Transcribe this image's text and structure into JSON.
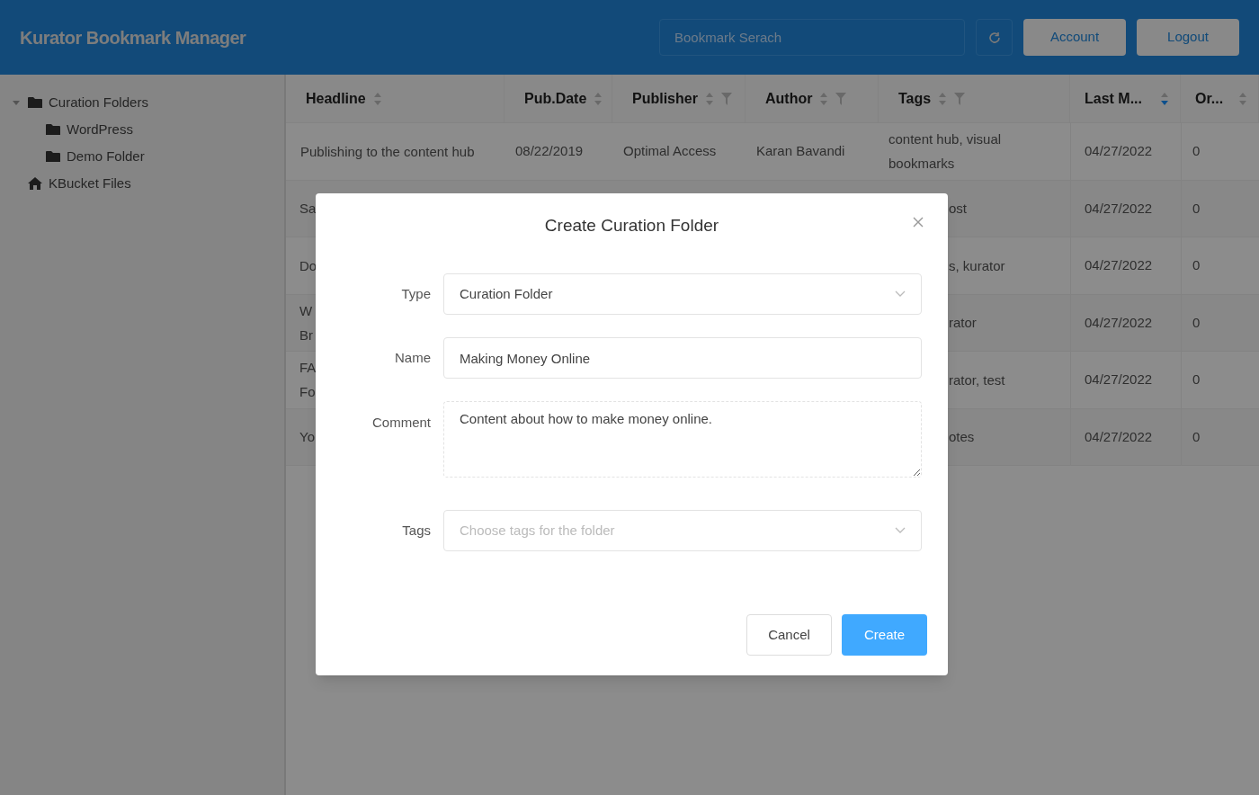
{
  "header": {
    "title": "Kurator Bookmark Manager",
    "search": {
      "placeholder": "Bookmark Serach"
    },
    "buttons": [
      "Account",
      "Logout"
    ]
  },
  "sidebar": {
    "tree": [
      {
        "label": "Curation Folders",
        "expanded": true,
        "children": [
          {
            "label": "WordPress"
          },
          {
            "label": "Demo Folder"
          }
        ]
      },
      {
        "label": "KBucket Files"
      }
    ]
  },
  "table": {
    "columns": [
      {
        "label": "Headline",
        "sorted": false,
        "filter": false
      },
      {
        "label": "Pub.Date",
        "sorted": false,
        "filter": false
      },
      {
        "label": "Publisher",
        "sorted": false,
        "filter": true
      },
      {
        "label": "Author",
        "sorted": false,
        "filter": true
      },
      {
        "label": "Tags",
        "sorted": false,
        "filter": true
      },
      {
        "label": "Last M...",
        "sorted": true,
        "filter": false
      },
      {
        "label": "Or...",
        "sorted": false,
        "filter": false
      }
    ],
    "rows": [
      {
        "headline": [
          "Publishing to the content hub"
        ],
        "pub_date": "08/22/2019",
        "publisher": "Optimal Access",
        "author": "Karan Bavandi",
        "tags": [
          "content hub, visual",
          "bookmarks"
        ],
        "last_modified": "04/27/2022",
        "order": "0"
      },
      {
        "headline": [
          "Sa"
        ],
        "tags": [
          "ost"
        ],
        "last_modified": "04/27/2022",
        "order": "0"
      },
      {
        "headline": [
          "Do"
        ],
        "tags": [
          "s, kurator"
        ],
        "last_modified": "04/27/2022",
        "order": "0"
      },
      {
        "headline": [
          "W",
          "Br"
        ],
        "tags": [
          "rator"
        ],
        "last_modified": "04/27/2022",
        "order": "0"
      },
      {
        "headline": [
          "FA",
          "Fo"
        ],
        "tags": [
          "rator, test"
        ],
        "last_modified": "04/27/2022",
        "order": "0"
      },
      {
        "headline": [
          "Yo"
        ],
        "tags": [
          "otes"
        ],
        "last_modified": "04/27/2022",
        "order": "0"
      }
    ]
  },
  "dialog": {
    "title": "Create Curation Folder",
    "fields": [
      {
        "kind": "select",
        "label": "Type",
        "value": "Curation Folder"
      },
      {
        "kind": "input",
        "label": "Name",
        "value": "Making Money Online"
      },
      {
        "kind": "textarea",
        "label": "Comment",
        "value": "Content about how to make money online."
      },
      {
        "kind": "select",
        "label": "Tags",
        "placeholder": "Choose tags for the folder"
      }
    ],
    "buttons": [
      {
        "label": "Cancel",
        "primary": false
      },
      {
        "label": "Create",
        "primary": true
      }
    ]
  }
}
